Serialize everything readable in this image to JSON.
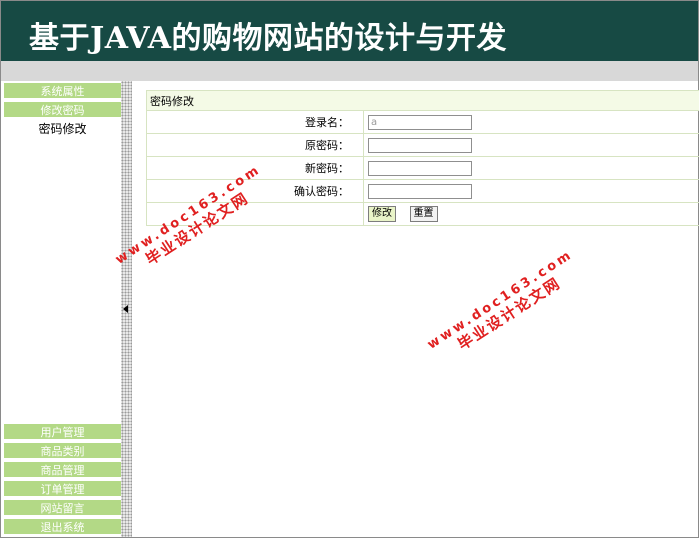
{
  "header": {
    "title": "基于JAVA的购物网站的设计与开发"
  },
  "sidebar": {
    "top_items": [
      "系统属性",
      "修改密码"
    ],
    "active_sub_item": "密码修改",
    "bottom_items": [
      "用户管理",
      "商品类别",
      "商品管理",
      "订单管理",
      "网站留言",
      "退出系统"
    ]
  },
  "form": {
    "heading": "密码修改",
    "fields": [
      {
        "label": "登录名：",
        "value": "a"
      },
      {
        "label": "原密码：",
        "value": ""
      },
      {
        "label": "新密码：",
        "value": ""
      },
      {
        "label": "确认密码：",
        "value": ""
      }
    ],
    "submit_label": "修改",
    "reset_label": "重置"
  },
  "watermarks": [
    {
      "cn": "毕业设计论文网",
      "url": "www.doc163.com"
    },
    {
      "cn": "毕业设计论文网",
      "url": "www.doc163.com"
    }
  ],
  "colors": {
    "header_bg": "#174a44",
    "nav_bg": "#b3d986",
    "watermark": "#e02020"
  }
}
